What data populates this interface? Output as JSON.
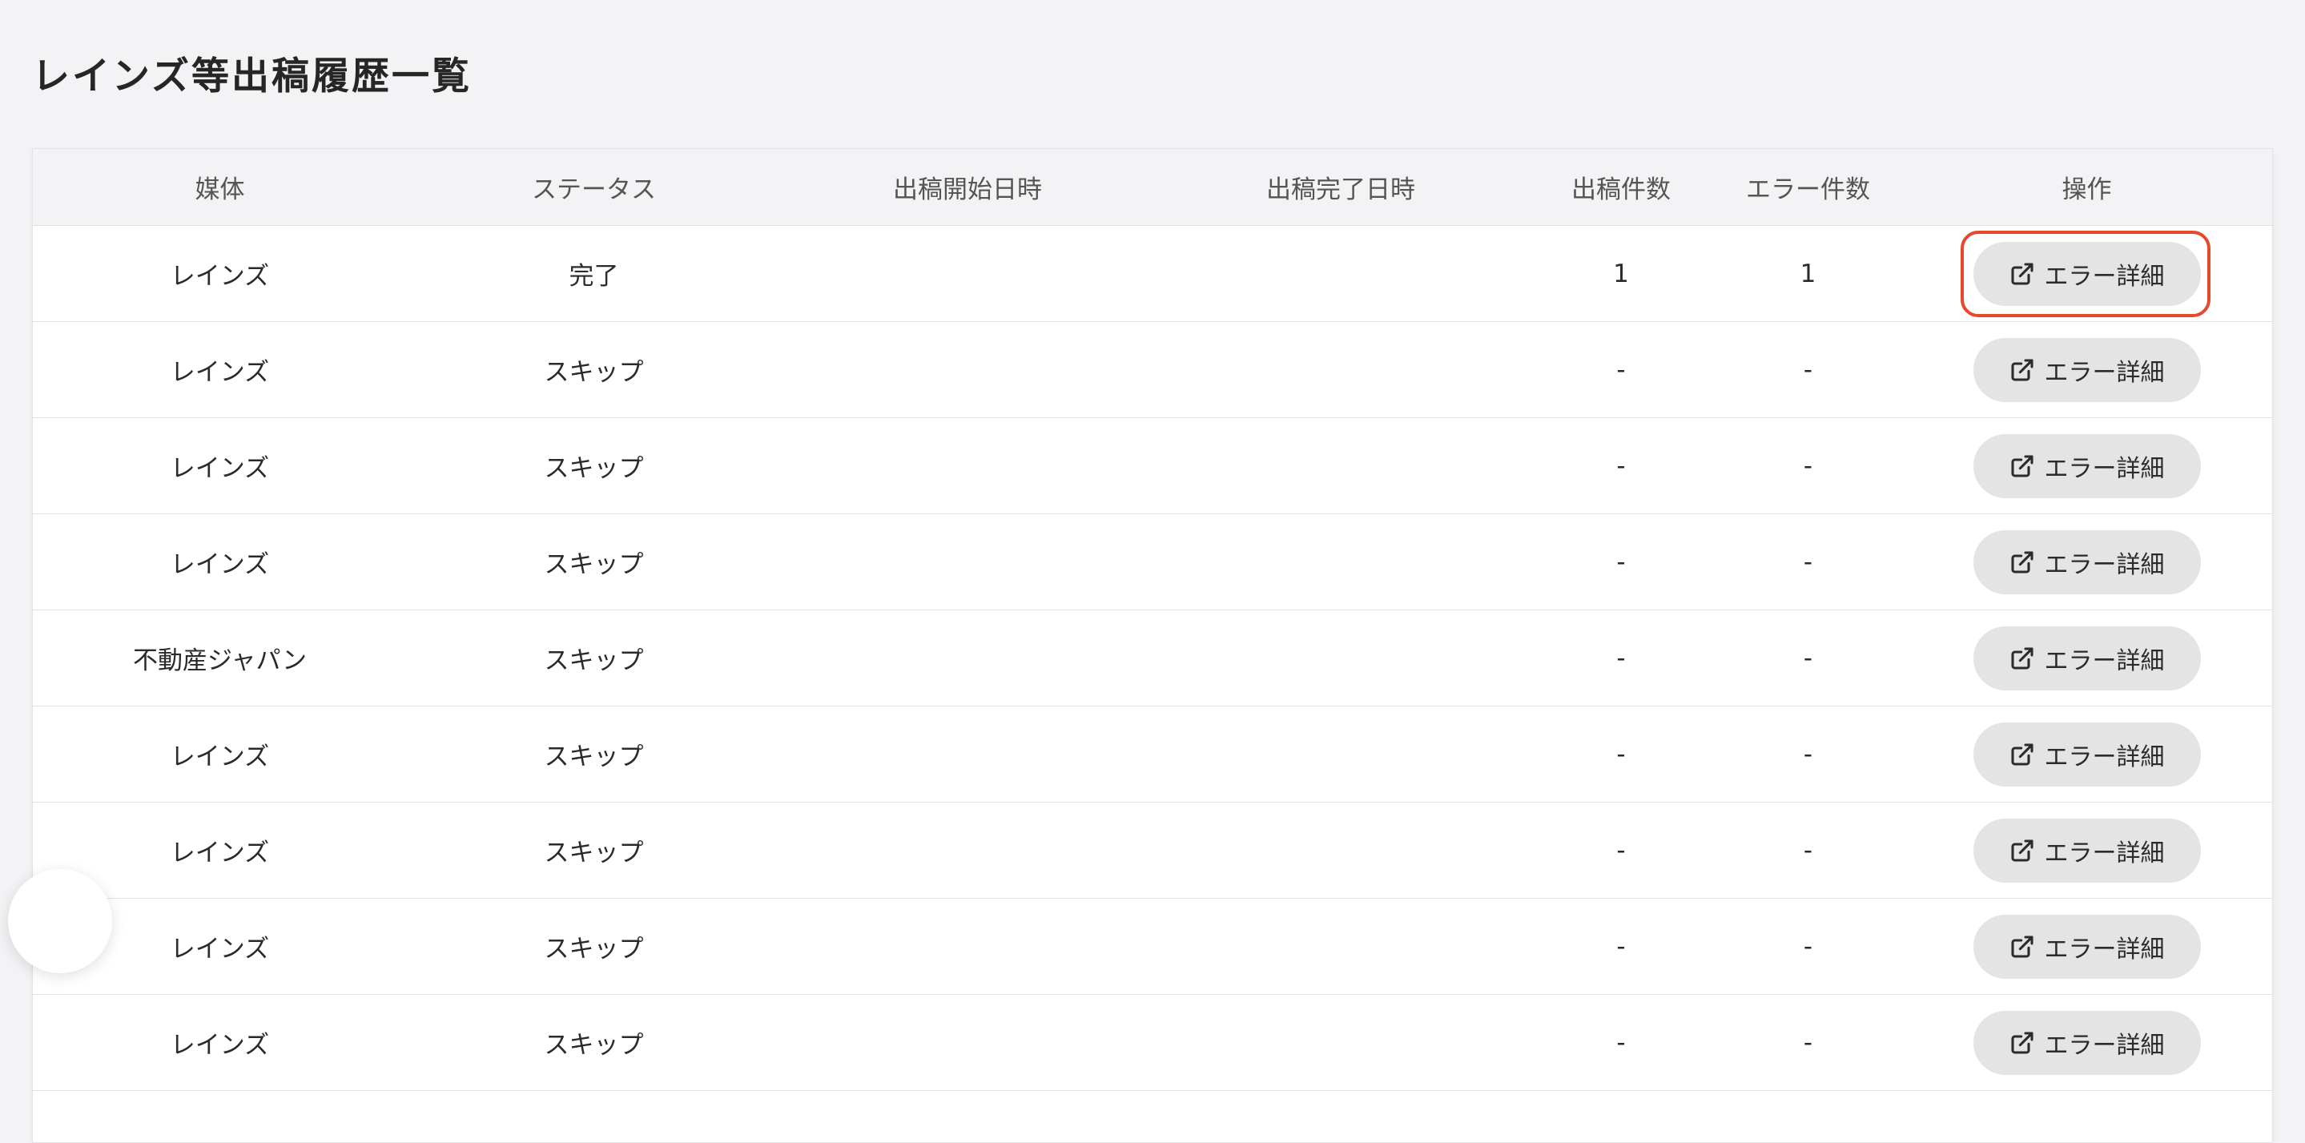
{
  "page": {
    "title": "レインズ等出稿履歴一覧"
  },
  "table": {
    "columns": [
      "媒体",
      "ステータス",
      "出稿開始日時",
      "出稿完了日時",
      "出稿件数",
      "エラー件数",
      "操作"
    ],
    "action_label": "エラー詳細",
    "rows": [
      {
        "medium": "レインズ",
        "status": "完了",
        "start": "",
        "end": "",
        "count": "1",
        "errors": "1",
        "action": "エラー詳細"
      },
      {
        "medium": "レインズ",
        "status": "スキップ",
        "start": "",
        "end": "",
        "count": "-",
        "errors": "-",
        "action": "エラー詳細"
      },
      {
        "medium": "レインズ",
        "status": "スキップ",
        "start": "",
        "end": "",
        "count": "-",
        "errors": "-",
        "action": "エラー詳細"
      },
      {
        "medium": "レインズ",
        "status": "スキップ",
        "start": "",
        "end": "",
        "count": "-",
        "errors": "-",
        "action": "エラー詳細"
      },
      {
        "medium": "不動産ジャパン",
        "status": "スキップ",
        "start": "",
        "end": "",
        "count": "-",
        "errors": "-",
        "action": "エラー詳細"
      },
      {
        "medium": "レインズ",
        "status": "スキップ",
        "start": "",
        "end": "",
        "count": "-",
        "errors": "-",
        "action": "エラー詳細"
      },
      {
        "medium": "レインズ",
        "status": "スキップ",
        "start": "",
        "end": "",
        "count": "-",
        "errors": "-",
        "action": "エラー詳細"
      },
      {
        "medium": "レインズ",
        "status": "スキップ",
        "start": "",
        "end": "",
        "count": "-",
        "errors": "-",
        "action": "エラー詳細"
      },
      {
        "medium": "レインズ",
        "status": "スキップ",
        "start": "",
        "end": "",
        "count": "-",
        "errors": "-",
        "action": "エラー詳細"
      }
    ]
  },
  "colors": {
    "background": "#f3f3f5",
    "button_bg": "#e4e4e4",
    "highlight": "#e8472a"
  },
  "icons": {
    "action_icon": "external-link-icon"
  }
}
